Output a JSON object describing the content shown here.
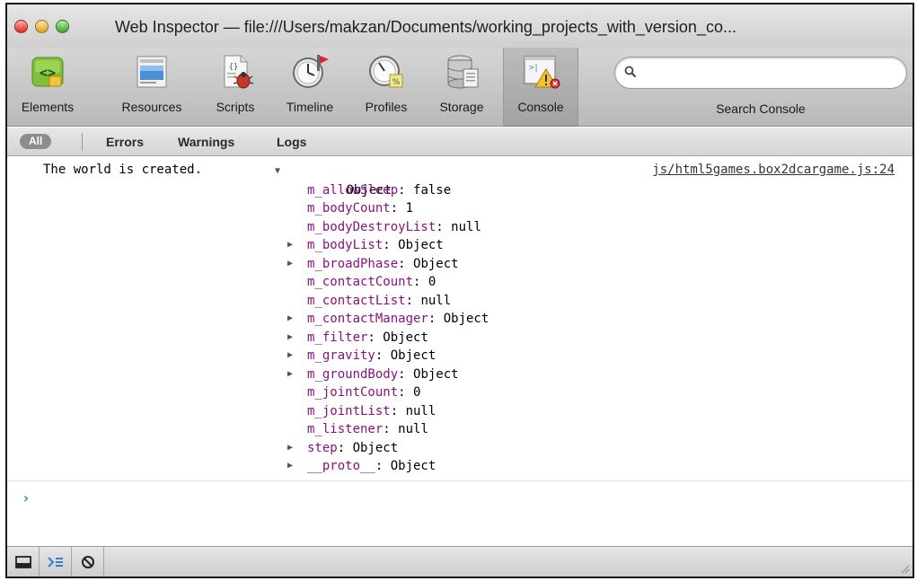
{
  "window": {
    "title": "Web Inspector — file:///Users/makzan/Documents/working_projects_with_version_co..."
  },
  "toolbar": {
    "items": [
      {
        "label": "Elements",
        "icon": "elements-icon"
      },
      {
        "label": "Resources",
        "icon": "resources-icon"
      },
      {
        "label": "Scripts",
        "icon": "scripts-icon"
      },
      {
        "label": "Timeline",
        "icon": "timeline-icon"
      },
      {
        "label": "Profiles",
        "icon": "profiles-icon"
      },
      {
        "label": "Storage",
        "icon": "storage-icon"
      },
      {
        "label": "Console",
        "icon": "console-icon",
        "active": true
      }
    ],
    "search": {
      "placeholder": "",
      "value": "",
      "label": "Search Console"
    }
  },
  "filters": {
    "all": "All",
    "errors": "Errors",
    "warnings": "Warnings",
    "logs": "Logs"
  },
  "console": {
    "message": "The world is created.",
    "source": "js/html5games.box2dcargame.js:24",
    "object_label": "Object",
    "properties": [
      {
        "key": "m_allowSleep",
        "value": "false",
        "expandable": false
      },
      {
        "key": "m_bodyCount",
        "value": "1",
        "expandable": false
      },
      {
        "key": "m_bodyDestroyList",
        "value": "null",
        "expandable": false
      },
      {
        "key": "m_bodyList",
        "value": "Object",
        "expandable": true
      },
      {
        "key": "m_broadPhase",
        "value": "Object",
        "expandable": true
      },
      {
        "key": "m_contactCount",
        "value": "0",
        "expandable": false
      },
      {
        "key": "m_contactList",
        "value": "null",
        "expandable": false
      },
      {
        "key": "m_contactManager",
        "value": "Object",
        "expandable": true
      },
      {
        "key": "m_filter",
        "value": "Object",
        "expandable": true
      },
      {
        "key": "m_gravity",
        "value": "Object",
        "expandable": true
      },
      {
        "key": "m_groundBody",
        "value": "Object",
        "expandable": true
      },
      {
        "key": "m_jointCount",
        "value": "0",
        "expandable": false
      },
      {
        "key": "m_jointList",
        "value": "null",
        "expandable": false
      },
      {
        "key": "m_listener",
        "value": "null",
        "expandable": false
      },
      {
        "key": "step",
        "value": "Object",
        "expandable": true
      },
      {
        "key": "__proto__",
        "value": "Object",
        "expandable": true
      }
    ],
    "prompt": "›"
  },
  "statusbar": {
    "buttons": [
      "dock-icon",
      "console-toggle-icon",
      "clear-console-icon"
    ]
  },
  "colors": {
    "property_key": "#881280",
    "prompt": "#3a7bd5"
  }
}
